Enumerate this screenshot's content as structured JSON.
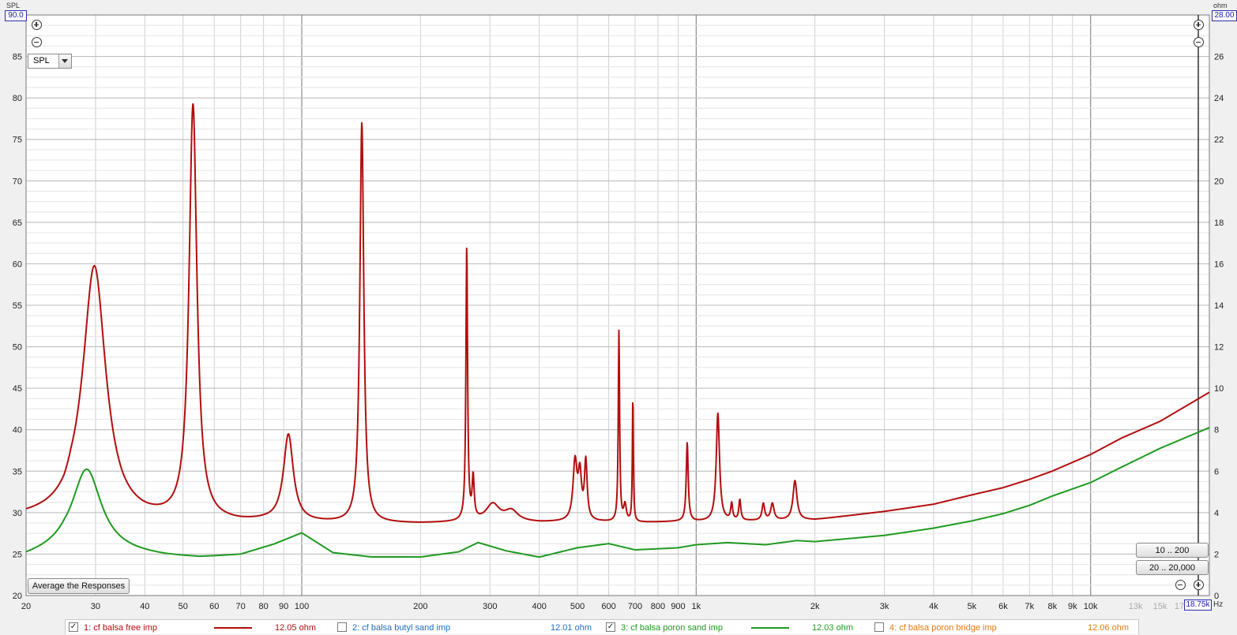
{
  "chart_data": {
    "type": "line",
    "x_scale": "log",
    "xlim": [
      20,
      20000
    ],
    "ylim_left": [
      20,
      90
    ],
    "ylim_right": [
      0,
      28
    ],
    "left_axis_label": "SPL",
    "right_axis_label": "ohm",
    "x_axis_unit": "Hz",
    "left_top_value": "90.0",
    "right_top_value": "28.00",
    "x_cursor_value": "18.75k",
    "x_ticks": [
      {
        "f": 20,
        "label": "20"
      },
      {
        "f": 30,
        "label": "30"
      },
      {
        "f": 40,
        "label": "40"
      },
      {
        "f": 50,
        "label": "50"
      },
      {
        "f": 60,
        "label": "60"
      },
      {
        "f": 70,
        "label": "70"
      },
      {
        "f": 80,
        "label": "80"
      },
      {
        "f": 90,
        "label": "90"
      },
      {
        "f": 100,
        "label": "100"
      },
      {
        "f": 200,
        "label": "200"
      },
      {
        "f": 300,
        "label": "300"
      },
      {
        "f": 400,
        "label": "400"
      },
      {
        "f": 500,
        "label": "500"
      },
      {
        "f": 600,
        "label": "600"
      },
      {
        "f": 700,
        "label": "700"
      },
      {
        "f": 800,
        "label": "800"
      },
      {
        "f": 900,
        "label": "900"
      },
      {
        "f": 1000,
        "label": "1k"
      },
      {
        "f": 2000,
        "label": "2k"
      },
      {
        "f": 3000,
        "label": "3k"
      },
      {
        "f": 4000,
        "label": "4k"
      },
      {
        "f": 5000,
        "label": "5k"
      },
      {
        "f": 6000,
        "label": "6k"
      },
      {
        "f": 7000,
        "label": "7k"
      },
      {
        "f": 8000,
        "label": "8k"
      },
      {
        "f": 9000,
        "label": "9k"
      },
      {
        "f": 10000,
        "label": "10k"
      },
      {
        "f": 13000,
        "label": "13k",
        "minor": true
      },
      {
        "f": 15000,
        "label": "15k",
        "minor": true
      },
      {
        "f": 17000,
        "label": "17k",
        "minor": true
      }
    ],
    "left_ticks": [
      20,
      25,
      30,
      35,
      40,
      45,
      50,
      55,
      60,
      65,
      70,
      75,
      80,
      85
    ],
    "right_ticks": [
      2,
      4,
      6,
      8,
      10,
      12,
      14,
      16,
      18,
      20,
      22,
      24,
      26
    ],
    "series": [
      {
        "name": "1: cf balsa free imp",
        "color": "#b20e0e",
        "value_label": "12.05 ohm",
        "checked": true,
        "baseline": [
          [
            20,
            3.7
          ],
          [
            25,
            3.75
          ],
          [
            26,
            4.0
          ],
          [
            30,
            3.85
          ],
          [
            35,
            3.55
          ],
          [
            40,
            3.5
          ],
          [
            60,
            3.45
          ],
          [
            70,
            3.45
          ],
          [
            80,
            3.5
          ],
          [
            100,
            3.45
          ],
          [
            150,
            3.45
          ],
          [
            200,
            3.45
          ],
          [
            300,
            3.55
          ],
          [
            400,
            3.5
          ],
          [
            500,
            3.55
          ],
          [
            700,
            3.5
          ],
          [
            900,
            3.55
          ],
          [
            1000,
            3.55
          ],
          [
            1500,
            3.6
          ],
          [
            2000,
            3.65
          ],
          [
            3000,
            4.05
          ],
          [
            4000,
            4.4
          ],
          [
            5000,
            4.85
          ],
          [
            6000,
            5.2
          ],
          [
            7000,
            5.6
          ],
          [
            8000,
            6.0
          ],
          [
            10000,
            6.8
          ],
          [
            12000,
            7.6
          ],
          [
            15000,
            8.4
          ],
          [
            20000,
            9.8
          ]
        ],
        "peaks": [
          {
            "f": 29.8,
            "a": 12.0,
            "w": 0.035
          },
          {
            "f": 53,
            "a": 20.0,
            "w": 0.012
          },
          {
            "f": 92.5,
            "a": 4.2,
            "w": 0.015
          },
          {
            "f": 142,
            "a": 19.3,
            "w": 0.006
          },
          {
            "f": 262,
            "a": 13.2,
            "w": 0.0025
          },
          {
            "f": 272,
            "a": 2.0,
            "w": 0.003
          },
          {
            "f": 305,
            "a": 0.8,
            "w": 0.02
          },
          {
            "f": 340,
            "a": 0.5,
            "w": 0.02
          },
          {
            "f": 493,
            "a": 2.8,
            "w": 0.006
          },
          {
            "f": 507,
            "a": 2.1,
            "w": 0.005
          },
          {
            "f": 525,
            "a": 2.8,
            "w": 0.004
          },
          {
            "f": 637,
            "a": 9.2,
            "w": 0.002
          },
          {
            "f": 660,
            "a": 0.8,
            "w": 0.004
          },
          {
            "f": 691,
            "a": 6.2,
            "w": 0.0015
          },
          {
            "f": 949,
            "a": 3.8,
            "w": 0.003
          },
          {
            "f": 1135,
            "a": 5.2,
            "w": 0.005
          },
          {
            "f": 1230,
            "a": 0.8,
            "w": 0.003
          },
          {
            "f": 1290,
            "a": 1.0,
            "w": 0.003
          },
          {
            "f": 1480,
            "a": 0.8,
            "w": 0.004
          },
          {
            "f": 1560,
            "a": 0.8,
            "w": 0.005
          },
          {
            "f": 1780,
            "a": 1.9,
            "w": 0.006
          }
        ]
      },
      {
        "name": "2: cf balsa butyl sand imp",
        "color": "#1f6fc0",
        "value_label": "12.01 ohm",
        "checked": false,
        "baseline": [],
        "peaks": []
      },
      {
        "name": "3: cf balsa poron sand imp",
        "color": "#1f9a1f",
        "value_label": "12.03 ohm",
        "checked": true,
        "baseline": [
          [
            20,
            1.8
          ],
          [
            25,
            2.15
          ],
          [
            35,
            2.0
          ],
          [
            45,
            1.85
          ],
          [
            55,
            1.8
          ],
          [
            60,
            1.85
          ],
          [
            70,
            1.95
          ],
          [
            85,
            2.45
          ],
          [
            100,
            3.0
          ],
          [
            120,
            2.05
          ],
          [
            150,
            1.85
          ],
          [
            200,
            1.85
          ],
          [
            250,
            2.1
          ],
          [
            280,
            2.55
          ],
          [
            330,
            2.15
          ],
          [
            400,
            1.85
          ],
          [
            500,
            2.3
          ],
          [
            600,
            2.5
          ],
          [
            700,
            2.2
          ],
          [
            900,
            2.3
          ],
          [
            1000,
            2.45
          ],
          [
            1200,
            2.55
          ],
          [
            1500,
            2.45
          ],
          [
            1800,
            2.65
          ],
          [
            2000,
            2.6
          ],
          [
            3000,
            2.9
          ],
          [
            4000,
            3.25
          ],
          [
            5000,
            3.6
          ],
          [
            6000,
            3.95
          ],
          [
            7000,
            4.35
          ],
          [
            8000,
            4.8
          ],
          [
            10000,
            5.45
          ],
          [
            12000,
            6.2
          ],
          [
            15000,
            7.1
          ],
          [
            20000,
            8.1
          ]
        ],
        "peaks": [
          {
            "f": 28.5,
            "a": 4.0,
            "w": 0.045
          }
        ]
      },
      {
        "name": "4: cf balsa poron bridge imp",
        "color": "#e07b10",
        "value_label": "12.06 ohm",
        "checked": false,
        "baseline": [],
        "peaks": []
      }
    ]
  },
  "controls": {
    "measure_select": "SPL",
    "average_button": "Average the Responses",
    "range_button_1": "10 .. 200",
    "range_button_2": "20 .. 20,000"
  }
}
